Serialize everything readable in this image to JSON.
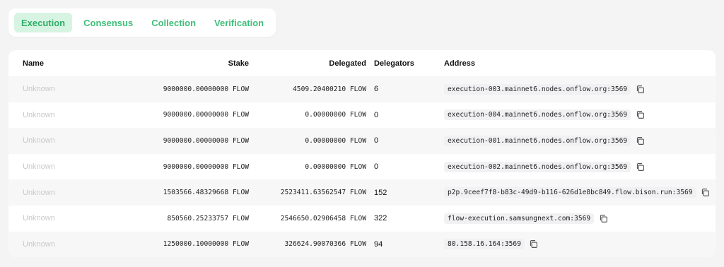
{
  "tabs": [
    {
      "label": "Execution",
      "active": true
    },
    {
      "label": "Consensus",
      "active": false
    },
    {
      "label": "Collection",
      "active": false
    },
    {
      "label": "Verification",
      "active": false
    }
  ],
  "table": {
    "headers": {
      "name": "Name",
      "stake": "Stake",
      "delegated": "Delegated",
      "delegators": "Delegators",
      "address": "Address"
    },
    "rows": [
      {
        "name": "Unknown",
        "stake": "9000000.00000000 FLOW",
        "delegated": "4509.20400210 FLOW",
        "delegators": "6",
        "address": "execution-003.mainnet6.nodes.onflow.org:3569"
      },
      {
        "name": "Unknown",
        "stake": "9000000.00000000 FLOW",
        "delegated": "0.00000000 FLOW",
        "delegators": "0",
        "address": "execution-004.mainnet6.nodes.onflow.org:3569"
      },
      {
        "name": "Unknown",
        "stake": "9000000.00000000 FLOW",
        "delegated": "0.00000000 FLOW",
        "delegators": "0",
        "address": "execution-001.mainnet6.nodes.onflow.org:3569"
      },
      {
        "name": "Unknown",
        "stake": "9000000.00000000 FLOW",
        "delegated": "0.00000000 FLOW",
        "delegators": "0",
        "address": "execution-002.mainnet6.nodes.onflow.org:3569"
      },
      {
        "name": "Unknown",
        "stake": "1503566.48329668 FLOW",
        "delegated": "2523411.63562547 FLOW",
        "delegators": "152",
        "address": "p2p.9ceef7f8-b83c-49d9-b116-626d1e8bc849.flow.bison.run:3569"
      },
      {
        "name": "Unknown",
        "stake": "850560.25233757 FLOW",
        "delegated": "2546650.02906458 FLOW",
        "delegators": "322",
        "address": "flow-execution.samsungnext.com:3569"
      },
      {
        "name": "Unknown",
        "stake": "1250000.10000000 FLOW",
        "delegated": "326624.90070366 FLOW",
        "delegators": "94",
        "address": "80.158.16.164:3569"
      }
    ]
  },
  "colors": {
    "accent": "#3fbf79",
    "active_tab_bg": "#d7f4e3",
    "muted_text": "#c9c9cc",
    "page_bg": "#f4f4f5"
  },
  "icons": {
    "copy": "copy-icon"
  }
}
